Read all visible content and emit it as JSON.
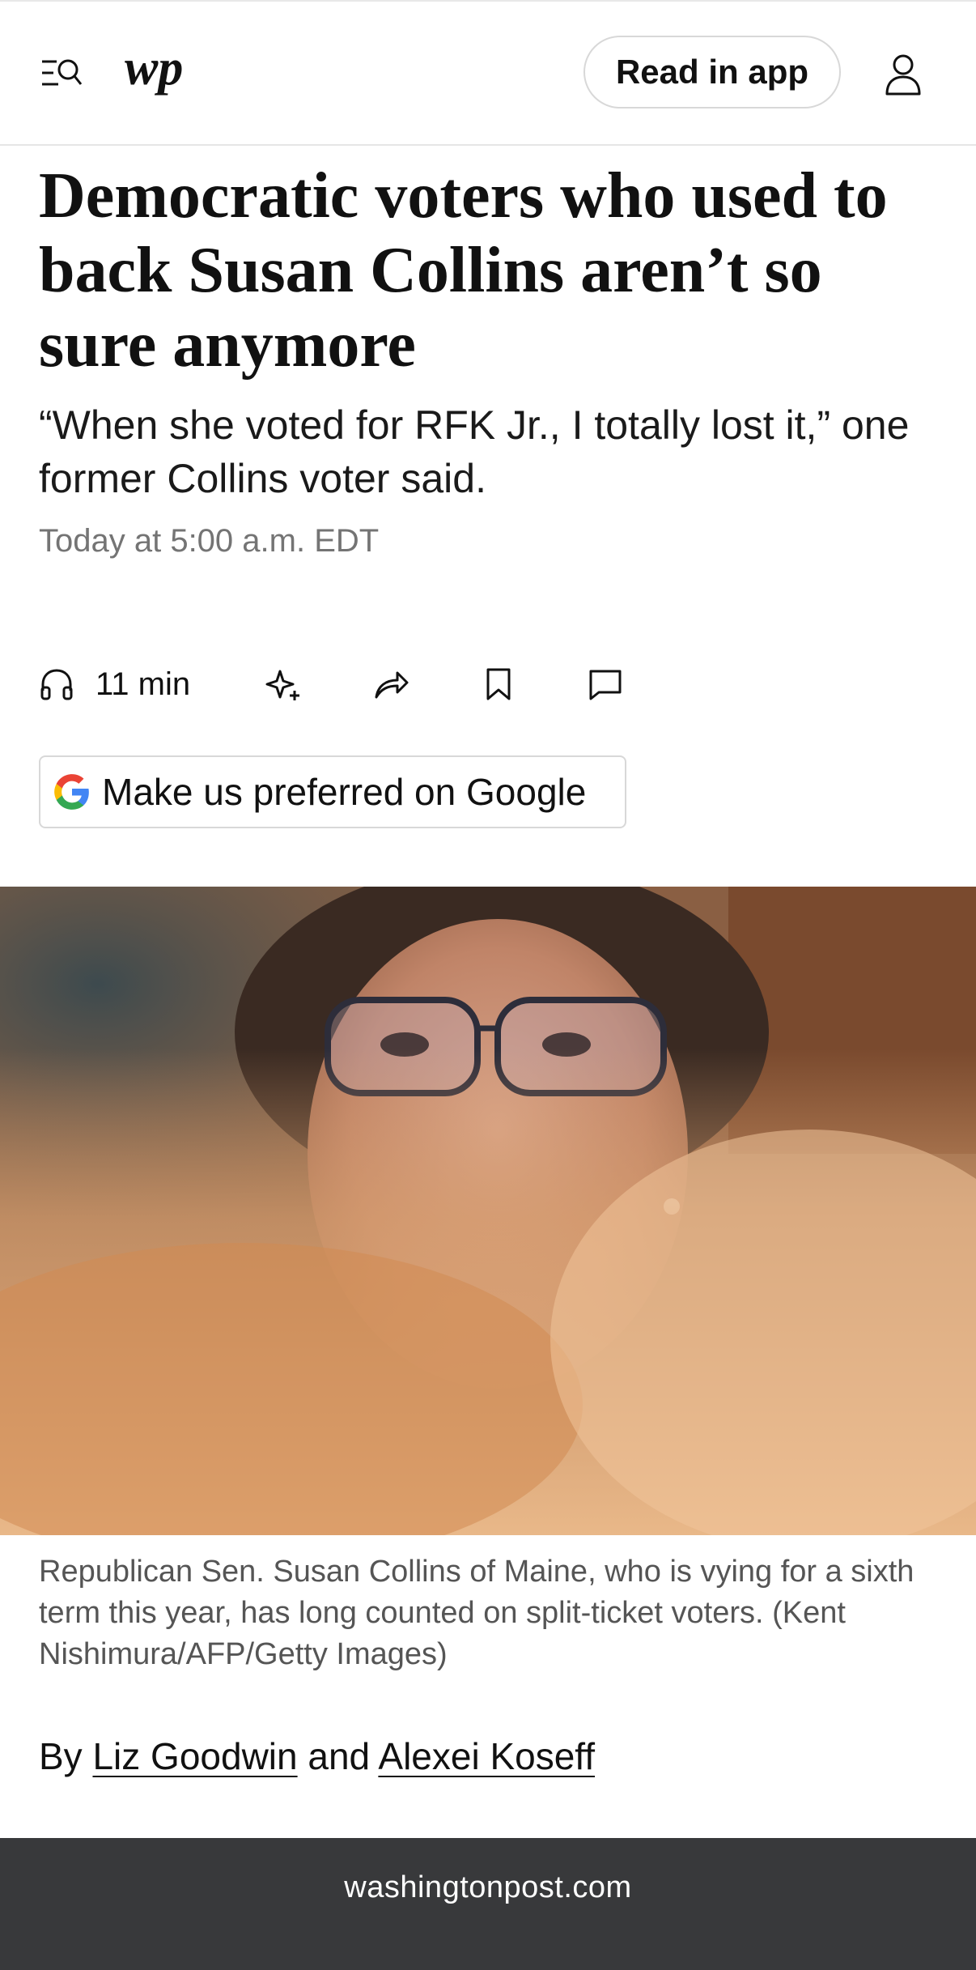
{
  "header": {
    "read_in_app": "Read in app"
  },
  "article": {
    "headline": "Democratic voters who used to back Susan Collins aren’t so sure anymore",
    "subhead": "“When she voted for RFK Jr., I totally lost it,” one former Collins voter said.",
    "timestamp": "Today at 5:00 a.m. EDT"
  },
  "actions": {
    "audio_duration": "11 min"
  },
  "google_pref": {
    "label": "Make us preferred on Google"
  },
  "photo": {
    "caption": "Republican Sen. Susan Collins of Maine, who is vying for a sixth term this year, has long counted on split-ticket voters. (Kent Nishimura/AFP/Getty Images)"
  },
  "byline": {
    "prefix": "By",
    "author1": "Liz Goodwin",
    "conjunction": "and",
    "author2": "Alexei Koseff"
  },
  "footer": {
    "url": "washingtonpost.com"
  }
}
